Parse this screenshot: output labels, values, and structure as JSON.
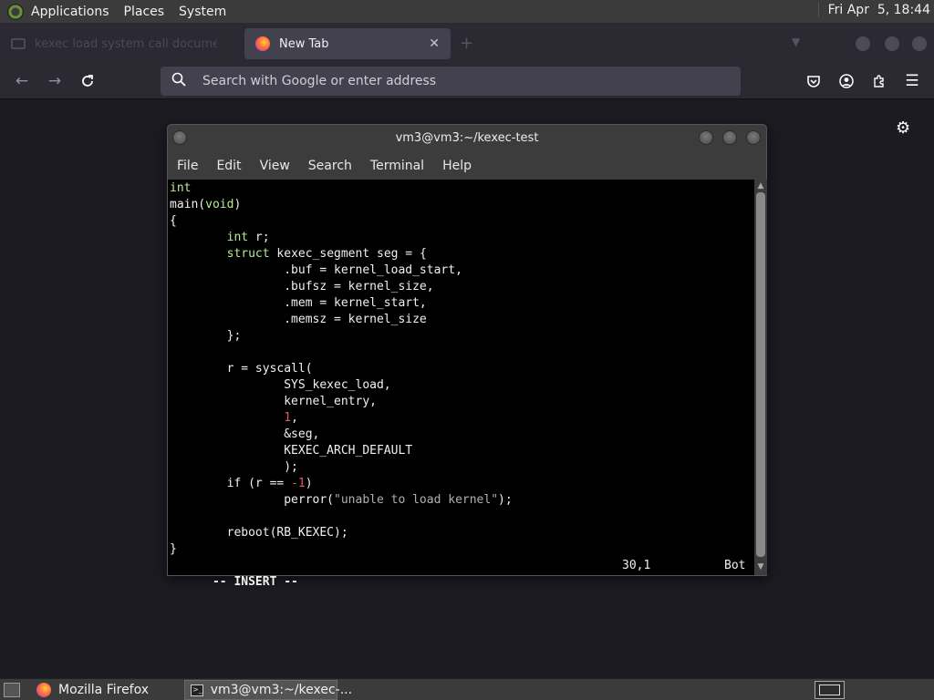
{
  "top_panel": {
    "menus": [
      "Applications",
      "Places",
      "System"
    ],
    "clock": "Fri Apr  5, 18:44"
  },
  "browser": {
    "ghost_tab_label": "kexec load system call documentation",
    "active_tab_label": "New Tab",
    "tab_close": "✕",
    "new_tab": "+",
    "url_placeholder": "Search with Google or enter address"
  },
  "icons": {
    "back": "back-arrow-icon",
    "forward": "forward-arrow-icon",
    "reload": "reload-icon",
    "search": "search-icon",
    "pocket": "pocket-icon",
    "account": "account-icon",
    "extensions": "extensions-icon",
    "menu": "hamburger-menu-icon",
    "settings": "gear-icon"
  },
  "terminal": {
    "title": "vm3@vm3:~/kexec-test",
    "menu": [
      "File",
      "Edit",
      "View",
      "Search",
      "Terminal",
      "Help"
    ],
    "code_lines": [
      "int",
      "main(void)",
      "{",
      "        int r;",
      "        struct kexec_segment seg = {",
      "                .buf = kernel_load_start,",
      "                .bufsz = kernel_size,",
      "                .mem = kernel_start,",
      "                .memsz = kernel_size",
      "        };",
      "",
      "        r = syscall(",
      "                SYS_kexec_load,",
      "                kernel_entry,",
      "                1,",
      "                &seg,",
      "                KEXEC_ARCH_DEFAULT",
      "                );",
      "        if (r == -1)",
      "                perror(\"unable to load kernel\");",
      "",
      "        reboot(RB_KEXEC);",
      "}"
    ],
    "mode": "-- INSERT --",
    "cursor_pos": "30,1",
    "scroll_pos": "Bot"
  },
  "taskbar": {
    "tasks": [
      "Mozilla Firefox",
      "vm3@vm3:~/kexec-..."
    ]
  }
}
